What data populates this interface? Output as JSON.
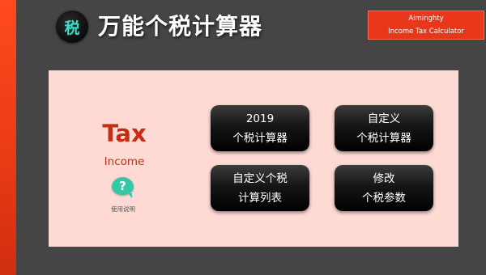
{
  "header": {
    "logo_text": "税",
    "title": "万能个税计算器"
  },
  "brand": {
    "line1": "Aiminghty",
    "line2": "Income Tax Calculator"
  },
  "panel": {
    "tax_title": "Tax",
    "income_label": "Income",
    "help_icon_text": "?",
    "help_label": "使用说明"
  },
  "menu": {
    "calc2019": {
      "line1": "2019",
      "line2": "个税计算器"
    },
    "custom_calc": {
      "line1": "自定义",
      "line2": "个税计算器"
    },
    "custom_table": {
      "line1": "自定义个税",
      "line2": "计算列表"
    },
    "edit_params": {
      "line1": "修改",
      "line2": "个税参数"
    }
  },
  "colors": {
    "accent": "#e8371b",
    "panel_bg": "#ffdad4",
    "background": "#454545",
    "help_icon": "#35c8a8",
    "tax_text": "#c52d14"
  }
}
